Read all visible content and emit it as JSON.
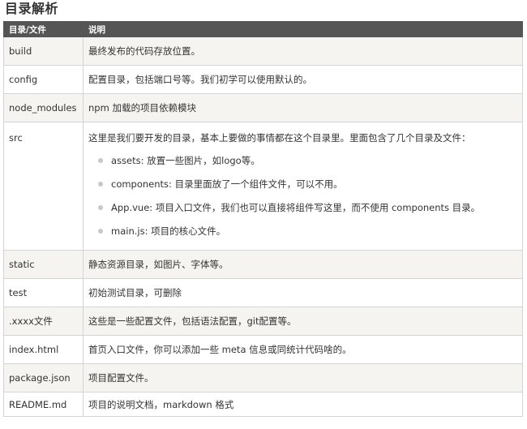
{
  "heading": "目录解析",
  "table": {
    "headers": [
      "目录/文件",
      "说明"
    ],
    "rows": [
      {
        "name": "build",
        "desc": "最终发布的代码存放位置。"
      },
      {
        "name": "config",
        "desc": "配置目录，包括端口号等。我们初学可以使用默认的。"
      },
      {
        "name": "node_modules",
        "desc": "npm 加载的项目依赖模块"
      },
      {
        "name": "src",
        "desc": "这里是我们要开发的目录，基本上要做的事情都在这个目录里。里面包含了几个目录及文件：",
        "items": [
          "assets: 放置一些图片，如logo等。",
          "components: 目录里面放了一个组件文件，可以不用。",
          "App.vue: 项目入口文件，我们也可以直接将组件写这里，而不使用 components 目录。",
          "main.js: 项目的核心文件。"
        ]
      },
      {
        "name": "static",
        "desc": "静态资源目录，如图片、字体等。"
      },
      {
        "name": "test",
        "desc": "初始测试目录，可删除"
      },
      {
        "name": ".xxxx文件",
        "desc": "这些是一些配置文件，包括语法配置，git配置等。"
      },
      {
        "name": "index.html",
        "desc": "首页入口文件，你可以添加一些 meta 信息或同统计代码啥的。"
      },
      {
        "name": "package.json",
        "desc": "项目配置文件。"
      },
      {
        "name": "README.md",
        "desc": "项目的说明文档，markdown 格式"
      }
    ]
  },
  "colors": {
    "header_bg": "#555555",
    "row_alt_bg": "#f6f4f0",
    "border": "#d4d4d4",
    "bullet": "#c8c8c8"
  }
}
